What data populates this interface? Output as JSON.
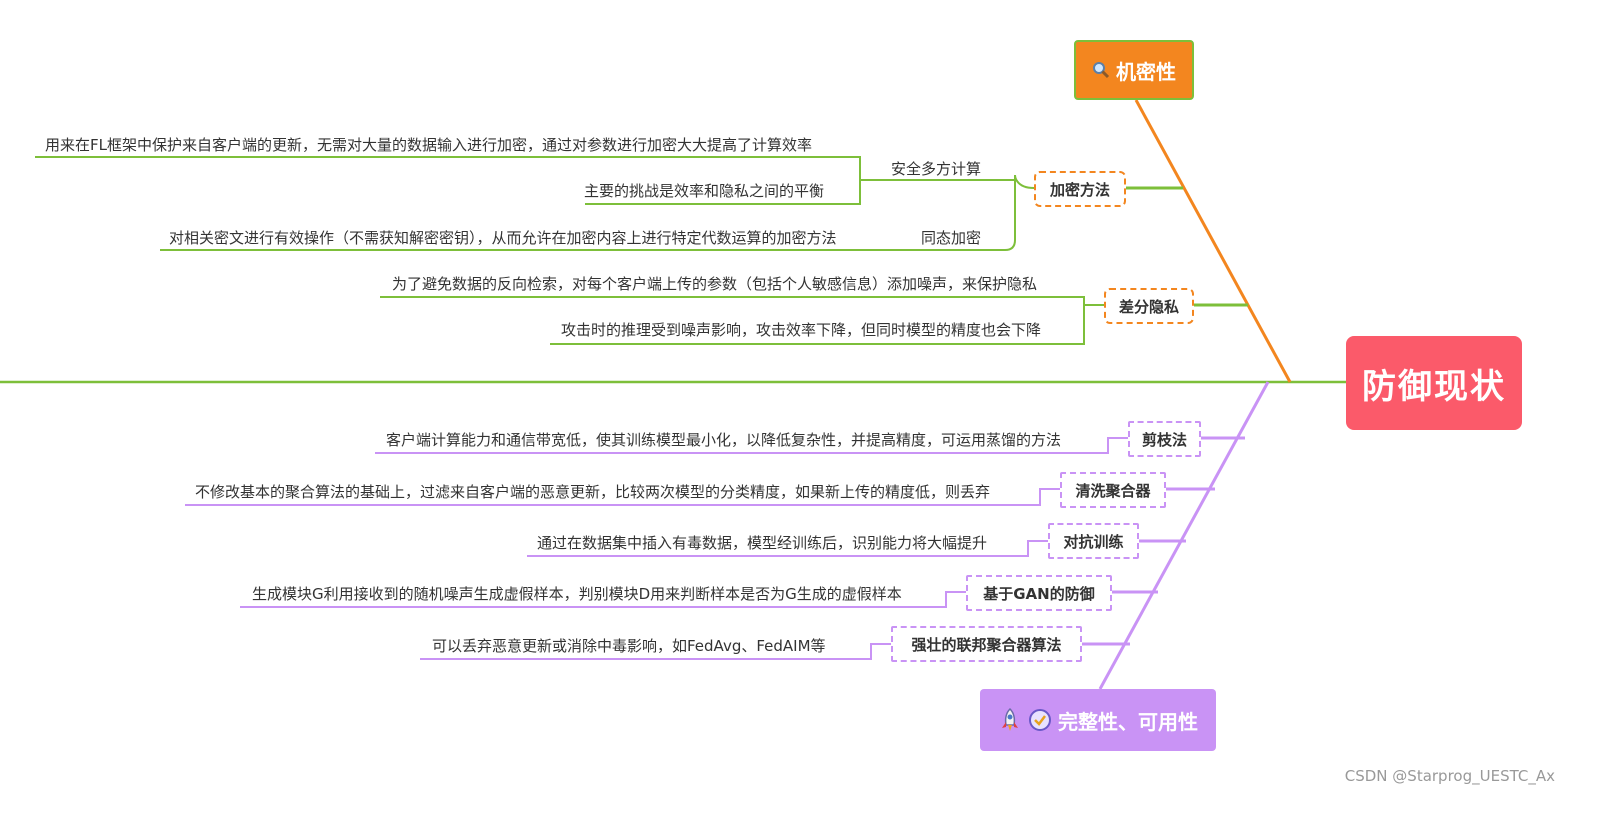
{
  "root": {
    "label": "防御现状"
  },
  "confidentiality": {
    "label": "机密性",
    "icon": "magnifier-icon",
    "encryption": {
      "label": "加密方法",
      "smpc": {
        "label": "安全多方计算",
        "details": [
          "用来在FL框架中保护来自客户端的更新，无需对大量的数据输入进行加密，通过对参数进行加密大大提高了计算效率",
          "主要的挑战是效率和隐私之间的平衡"
        ]
      },
      "he": {
        "label": "同态加密",
        "details": [
          "对相关密文进行有效操作（不需获知解密密钥），从而允许在加密内容上进行特定代数运算的加密方法"
        ]
      }
    },
    "dp": {
      "label": "差分隐私",
      "details": [
        "为了避免数据的反向检索，对每个客户端上传的参数（包括个人敏感信息）添加噪声，来保护隐私",
        "攻击时的推理受到噪声影响，攻击效率下降，但同时模型的精度也会下降"
      ]
    }
  },
  "integrity": {
    "label": "完整性、可用性",
    "icons": [
      "rocket-icon",
      "check-badge-icon"
    ],
    "items": [
      {
        "label": "剪枝法",
        "detail": "客户端计算能力和通信带宽低，使其训练模型最小化，以降低复杂性，并提高精度，可运用蒸馏的方法"
      },
      {
        "label": "清洗聚合器",
        "detail": "不修改基本的聚合算法的基础上，过滤来自客户端的恶意更新，比较两次模型的分类精度，如果新上传的精度低，则丢弃"
      },
      {
        "label": "对抗训练",
        "detail": "通过在数据集中插入有毒数据，模型经训练后，识别能力将大幅提升"
      },
      {
        "label": "基于GAN的防御",
        "detail": "生成模块G利用接收到的随机噪声生成虚假样本，判别模块D用来判断样本是否为G生成的虚假样本"
      },
      {
        "label": "强壮的联邦聚合器算法",
        "detail": "可以丢弃恶意更新或消除中毒影响，如FedAvg、FedAIM等"
      }
    ]
  },
  "watermark": "CSDN @Starprog_UESTC_Ax",
  "colors": {
    "root": "#fb5a6a",
    "confidentiality": "#f3861f",
    "green_line": "#7dbf3a",
    "integrity": "#c993f5"
  }
}
